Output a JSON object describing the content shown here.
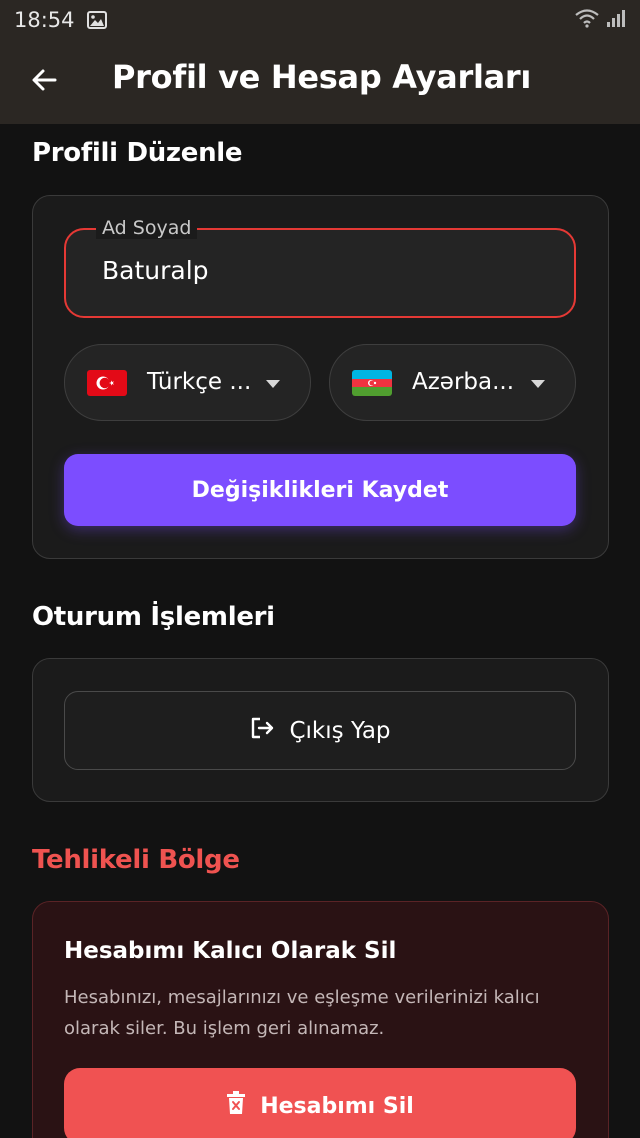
{
  "status_bar": {
    "time": "18:54",
    "icons": [
      "image-icon",
      "wifi-icon",
      "signal-icon"
    ]
  },
  "app_bar": {
    "back_icon": "arrow-left-icon",
    "title": "Profil ve Hesap Ayarları"
  },
  "profile_section": {
    "title": "Profili Düzenle",
    "name_field": {
      "label": "Ad Soyad",
      "value": "Baturalp",
      "state": "error",
      "border_color": "#e53935"
    },
    "language_select": {
      "flag": "turkey-flag-icon",
      "value": "Türkçe ..."
    },
    "country_select": {
      "flag": "azerbaijan-flag-icon",
      "value": "Azərba..."
    },
    "save_button": {
      "label": "Değişiklikleri Kaydet",
      "color": "#7c4dff"
    }
  },
  "session_section": {
    "title": "Oturum İşlemleri",
    "logout_button": {
      "icon": "logout-icon",
      "label": "Çıkış Yap"
    }
  },
  "danger_section": {
    "title": "Tehlikeli Bölge",
    "title_color": "#ef5350",
    "card_title": "Hesabımı Kalıcı Olarak Sil",
    "description": "Hesabınızı, mesajlarınızı ve eşleşme verilerinizi kalıcı olarak siler. Bu işlem geri alınamaz.",
    "delete_button": {
      "icon": "trash-icon",
      "label": "Hesabımı Sil",
      "color": "#f05252"
    }
  }
}
